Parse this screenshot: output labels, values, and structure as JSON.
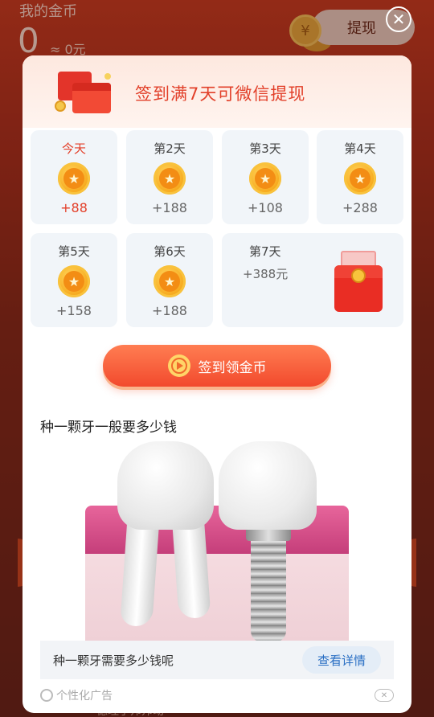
{
  "background": {
    "title": "我的金币",
    "balance": "0",
    "approx": "≈ 0元",
    "coin_symbol": "¥",
    "withdraw_label": "提现",
    "bottom_text": "德理手邦邦动"
  },
  "dialog": {
    "close_icon": "✕",
    "title": "签到满7天可微信提现",
    "days": [
      {
        "label": "今天",
        "amount": "+88",
        "is_today": true
      },
      {
        "label": "第2天",
        "amount": "+188"
      },
      {
        "label": "第3天",
        "amount": "+108"
      },
      {
        "label": "第4天",
        "amount": "+288"
      },
      {
        "label": "第5天",
        "amount": "+158"
      },
      {
        "label": "第6天",
        "amount": "+188"
      },
      {
        "label": "第7天",
        "amount": "+388元"
      }
    ],
    "coin_icon": "★",
    "checkin_button": "签到领金币"
  },
  "ad": {
    "title": "种一颗牙一般要多少钱",
    "description": "种一颗牙需要多少钱呢",
    "detail_button": "查看详情",
    "tag_label": "个性化广告",
    "close_icon": "✕"
  },
  "colors": {
    "accent": "#e3402a",
    "button_start": "#ff7d52",
    "button_end": "#f24a2d",
    "day_card_bg": "#f1f5f9",
    "link": "#2a6fc4"
  }
}
